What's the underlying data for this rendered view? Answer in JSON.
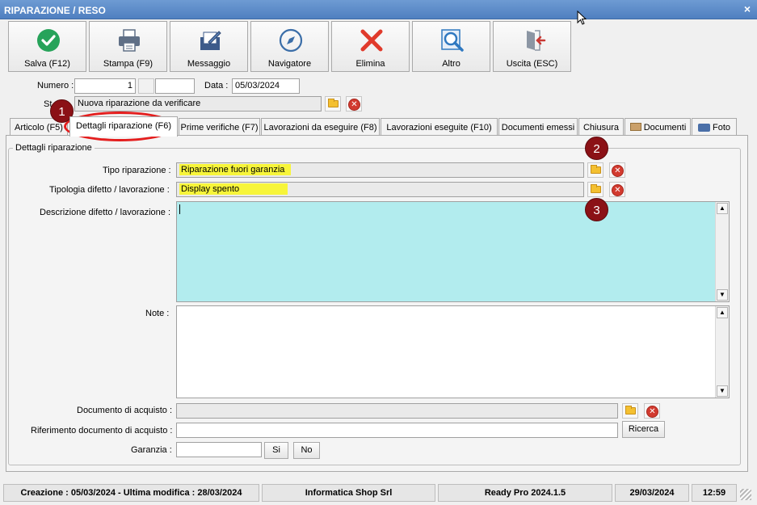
{
  "window": {
    "title": "RIPARAZIONE / RESO",
    "close_glyph": "×"
  },
  "toolbar": [
    {
      "label": "Salva (F12)",
      "icon": "check-circle-icon",
      "color": "#27a35a"
    },
    {
      "label": "Stampa (F9)",
      "icon": "printer-icon",
      "color": "#5f6f86"
    },
    {
      "label": "Messaggio",
      "icon": "message-pencil-icon",
      "color": "#3d5b8a"
    },
    {
      "label": "Navigatore",
      "icon": "compass-icon",
      "color": "#3b6ea8"
    },
    {
      "label": "Elimina",
      "icon": "delete-x-icon",
      "color": "#e03a2b"
    },
    {
      "label": "Altro",
      "icon": "search-doc-icon",
      "color": "#2f78c0"
    },
    {
      "label": "Uscita (ESC)",
      "icon": "exit-door-icon",
      "color": "#c93a35"
    }
  ],
  "header": {
    "numero_label": "Numero :",
    "numero_value": "1",
    "data_label": "Data :",
    "data_value": "05/03/2024",
    "stato_label": "St",
    "stato_value": "Nuova riparazione da verificare"
  },
  "tabs": [
    {
      "label": "Articolo (F5)"
    },
    {
      "label": "Dettagli riparazione (F6)"
    },
    {
      "label": "Prime verifiche (F7)"
    },
    {
      "label": "Lavorazioni da eseguire (F8)"
    },
    {
      "label": "Lavorazioni eseguite  (F10)"
    },
    {
      "label": "Documenti emessi"
    },
    {
      "label": "Chiusura"
    },
    {
      "label": "Documenti",
      "icon": "folder-icon"
    },
    {
      "label": "Foto",
      "icon": "camera-icon"
    }
  ],
  "details": {
    "group_title": "Dettagli riparazione",
    "tipo_label": "Tipo riparazione :",
    "tipo_value": "Riparazione fuori garanzia",
    "tipologia_label": "Tipologia difetto / lavorazione :",
    "tipologia_value": "Display spento",
    "descrizione_label": "Descrizione difetto / lavorazione :",
    "descrizione_value": "",
    "note_label": "Note :",
    "note_value": "",
    "doc_acquisto_label": "Documento di acquisto :",
    "doc_acquisto_value": "",
    "rif_doc_label": "Riferimento documento di acquisto :",
    "rif_doc_value": "",
    "ricerca_label": "Ricerca",
    "garanzia_label": "Garanzia :",
    "garanzia_value": "",
    "si_label": "Si",
    "no_label": "No"
  },
  "annotations": {
    "badge1": "1",
    "badge2": "2",
    "badge3": "3"
  },
  "status": {
    "created": "Creazione : 05/03/2024 - Ultima modifica : 28/03/2024",
    "company": "Informatica Shop Srl",
    "product": "Ready Pro 2024.1.5",
    "date": "29/03/2024",
    "time": "12:59"
  },
  "colors": {
    "titlebar": "#5b89c8",
    "highlight": "#f7f53a",
    "description_bg": "#b2ecee",
    "badge": "#8b1116",
    "ring": "#e41e1e"
  }
}
